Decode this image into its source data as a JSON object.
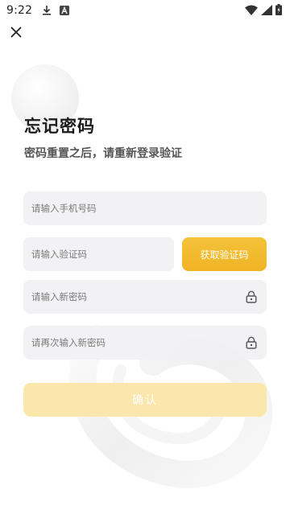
{
  "status_bar": {
    "time": "9:22",
    "icons": [
      "download-icon",
      "notification-a-icon",
      "wifi-icon",
      "signal-icon",
      "battery-icon"
    ]
  },
  "header": {
    "close_icon": "close-icon"
  },
  "page": {
    "title": "忘记密码",
    "subtitle": "密码重置之后，请重新登录验证"
  },
  "form": {
    "phone": {
      "value": "",
      "placeholder": "请输入手机号码"
    },
    "code": {
      "value": "",
      "placeholder": "请输入验证码"
    },
    "get_code_label": "获取验证码",
    "new_password": {
      "value": "",
      "placeholder": "请输入新密码",
      "icon": "lock-icon"
    },
    "confirm_password": {
      "value": "",
      "placeholder": "请再次输入新密码",
      "icon": "lock-icon"
    },
    "confirm_label": "确认"
  },
  "colors": {
    "accent": "#f0b325",
    "accent_disabled": "#fbe6ab",
    "field_bg": "#f1f1f3"
  }
}
